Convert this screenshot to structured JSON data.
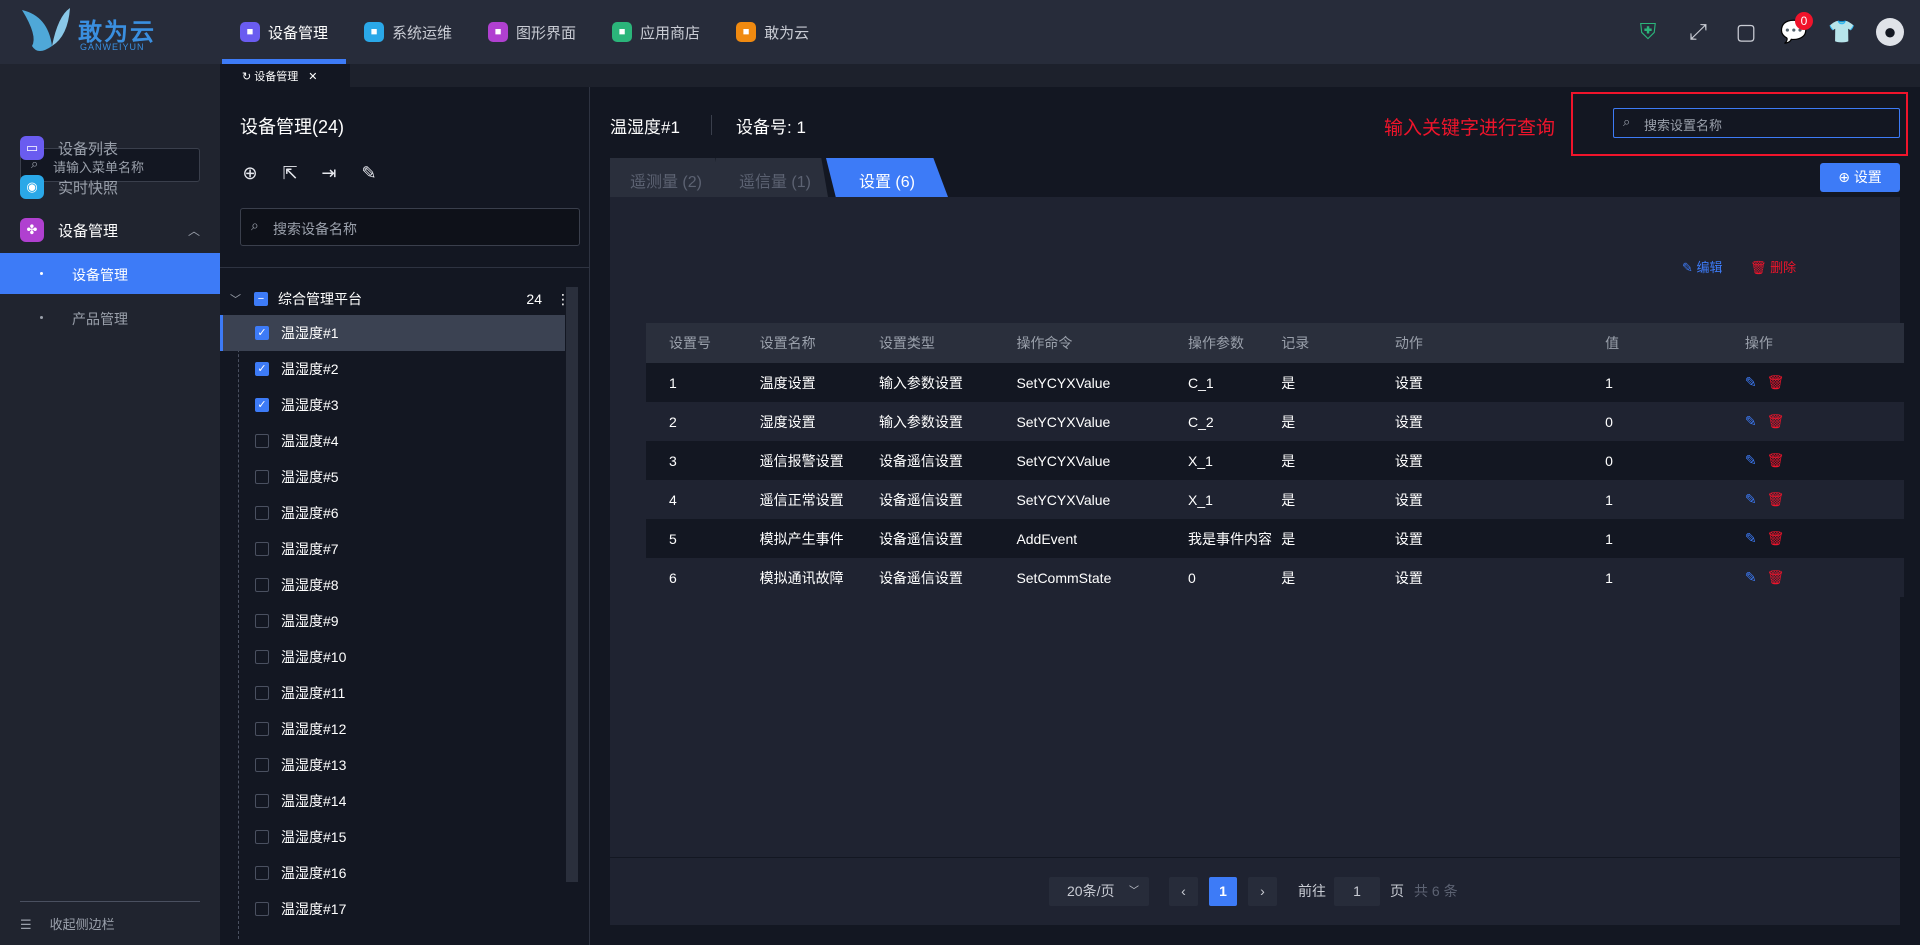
{
  "header": {
    "logo_text": "敢为云",
    "logo_sub": "GANWEIYUN",
    "nav": [
      {
        "label": "设备管理",
        "color": "#6a5cf0",
        "icon": "device-icon"
      },
      {
        "label": "系统运维",
        "color": "#2aa8e8",
        "icon": "wrench-icon"
      },
      {
        "label": "图形界面",
        "color": "#b040d0",
        "icon": "monitor-icon"
      },
      {
        "label": "应用商店",
        "color": "#2bb57a",
        "icon": "store-icon"
      },
      {
        "label": "敢为云",
        "color": "#f08a10",
        "icon": "cloud-icon"
      }
    ],
    "badge": "0"
  },
  "page_tab": "设备管理",
  "sidebar": {
    "search_placeholder": "请输入菜单名称",
    "items": [
      {
        "label": "设备列表",
        "color": "#6a5cf0"
      },
      {
        "label": "实时快照",
        "color": "#2aa8e8"
      },
      {
        "label": "设备管理",
        "color": "#b040d0"
      }
    ],
    "subitems": [
      "设备管理",
      "产品管理"
    ],
    "collapse": "收起侧边栏"
  },
  "tree": {
    "title": "设备管理(24)",
    "search_placeholder": "搜索设备名称",
    "root": "综合管理平台",
    "root_count": "24",
    "items": [
      "温湿度#1",
      "温湿度#2",
      "温湿度#3",
      "温湿度#4",
      "温湿度#5",
      "温湿度#6",
      "温湿度#7",
      "温湿度#8",
      "温湿度#9",
      "温湿度#10",
      "温湿度#11",
      "温湿度#12",
      "温湿度#13",
      "温湿度#14",
      "温湿度#15",
      "温湿度#16",
      "温湿度#17"
    ],
    "checked": 3
  },
  "main": {
    "device_name": "温湿度#1",
    "device_no": "设备号:  1",
    "hint": "输入关键字进行查询",
    "search_placeholder": "搜索设置名称",
    "tabs": [
      "遥测量 (2)",
      "遥信量 (1)",
      "设置 (6)"
    ],
    "edit": "编辑",
    "delete": "删除",
    "add": "设置",
    "columns": [
      "设置号",
      "设置名称",
      "设置类型",
      "操作命令",
      "操作参数",
      "记录",
      "动作",
      "值",
      "操作"
    ],
    "rows": [
      [
        "1",
        "温度设置",
        "输入参数设置",
        "SetYCYXValue",
        "C_1",
        "是",
        "设置",
        "1"
      ],
      [
        "2",
        "湿度设置",
        "输入参数设置",
        "SetYCYXValue",
        "C_2",
        "是",
        "设置",
        "0"
      ],
      [
        "3",
        "遥信报警设置",
        "设备遥信设置",
        "SetYCYXValue",
        "X_1",
        "是",
        "设置",
        "0"
      ],
      [
        "4",
        "遥信正常设置",
        "设备遥信设置",
        "SetYCYXValue",
        "X_1",
        "是",
        "设置",
        "1"
      ],
      [
        "5",
        "模拟产生事件",
        "设备遥信设置",
        "AddEvent",
        "我是事件内容",
        "是",
        "设置",
        "1"
      ],
      [
        "6",
        "模拟通讯故障",
        "设备遥信设置",
        "SetCommState",
        "0",
        "是",
        "设置",
        "1"
      ]
    ],
    "pager": {
      "size": "20条/页",
      "page": "1",
      "goto": "前往",
      "goto_value": "1",
      "page_unit": "页",
      "total": "共 6 条"
    }
  }
}
